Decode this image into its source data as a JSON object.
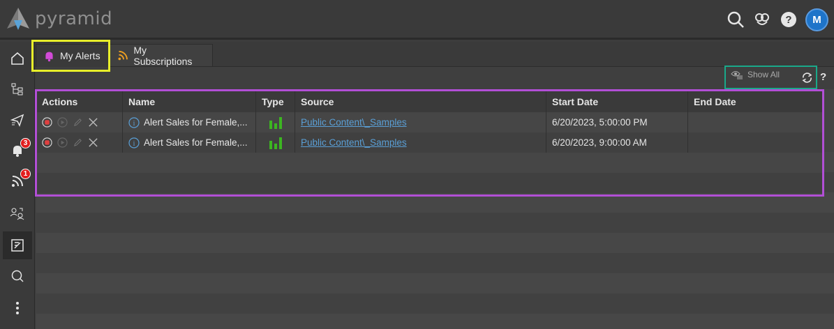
{
  "app": {
    "name": "pyramid",
    "avatar_initial": "M",
    "accent": "#1e74c9"
  },
  "rail": {
    "alerts_badge": "3",
    "subscriptions_badge": "1"
  },
  "tabs": [
    {
      "label": "My Alerts",
      "icon": "bell-icon",
      "icon_color": "#d24bd8"
    },
    {
      "label": "My Subscriptions",
      "icon": "rss-icon",
      "icon_color": "#f0a020"
    }
  ],
  "toolbar": {
    "show_all_label": "Show All",
    "help": "?"
  },
  "grid": {
    "columns": [
      "Actions",
      "Name",
      "Type",
      "Source",
      "Start Date",
      "End Date"
    ],
    "rows": [
      {
        "name": "Alert Sales for Female,...",
        "type_icon": "bar-chart-icon",
        "source": "Public Content\\_Samples",
        "start_date": "6/20/2023, 5:00:00 PM",
        "end_date": ""
      },
      {
        "name": "Alert Sales for Female,...",
        "type_icon": "bar-chart-icon",
        "source": "Public Content\\_Samples",
        "start_date": "6/20/2023, 9:00:00 AM",
        "end_date": ""
      }
    ]
  },
  "highlight_colors": {
    "tab": "#e8ee2a",
    "toolbar": "#19a98a",
    "grid": "#b24fd6"
  }
}
